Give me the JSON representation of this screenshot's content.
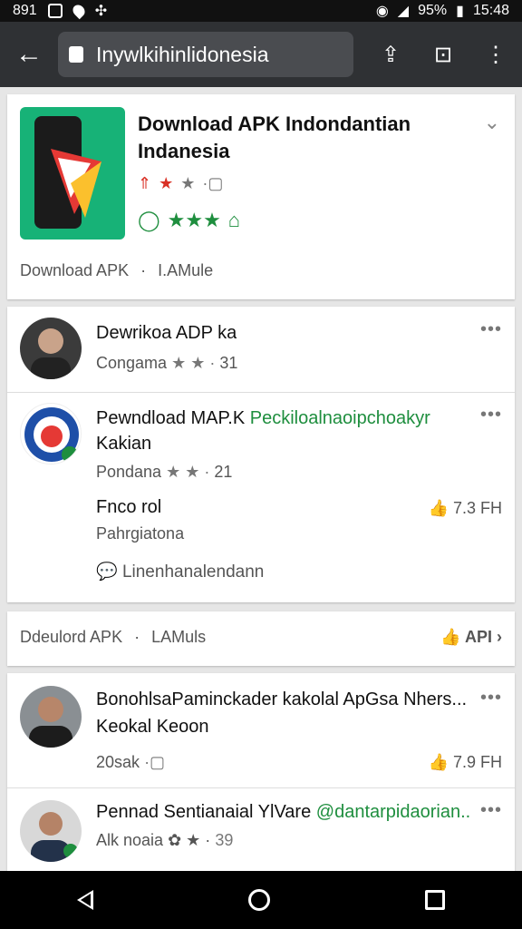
{
  "status_bar": {
    "left_text": "891",
    "battery": "95%",
    "time": "15:48"
  },
  "browser": {
    "url": "Inywlkihinlidonesia"
  },
  "app_card": {
    "title": "Download APK Indondantian Indanesia",
    "caption_left": "Download APK",
    "caption_right": "I.AMule"
  },
  "post1": {
    "title": "Dewrikoa ADP ka",
    "sub": "Congama",
    "count": "31"
  },
  "post2": {
    "title_black": "Pewndload MAP.K ",
    "title_green": "Peckiloalnaoipchoakyr",
    "line2": "Kakian",
    "sub": "Pondana",
    "count": "21",
    "label": "Fnco rol",
    "label_right": "7.3 FH",
    "author": "Pahrgiatona",
    "comment": "Linenhanalendann"
  },
  "section2": {
    "left": "Ddeulord APK",
    "right_small": "LAMuls",
    "action": "API"
  },
  "post3": {
    "title": "BonohlsaPaminckader kakolal ApGsa Nhers...",
    "line2": "Keokal Keoon",
    "meta": "20sak",
    "right_val": "7.9 FH"
  },
  "post4": {
    "title_black": "Pennad Sentianaial YlVare ",
    "title_green": "@dantarpidaorian..",
    "line2": "Alk noaia",
    "count": "39"
  },
  "colors": {
    "accent_green": "#1e8e3e",
    "toolbar": "#2f3134",
    "app_icon_bg": "#17b277"
  }
}
